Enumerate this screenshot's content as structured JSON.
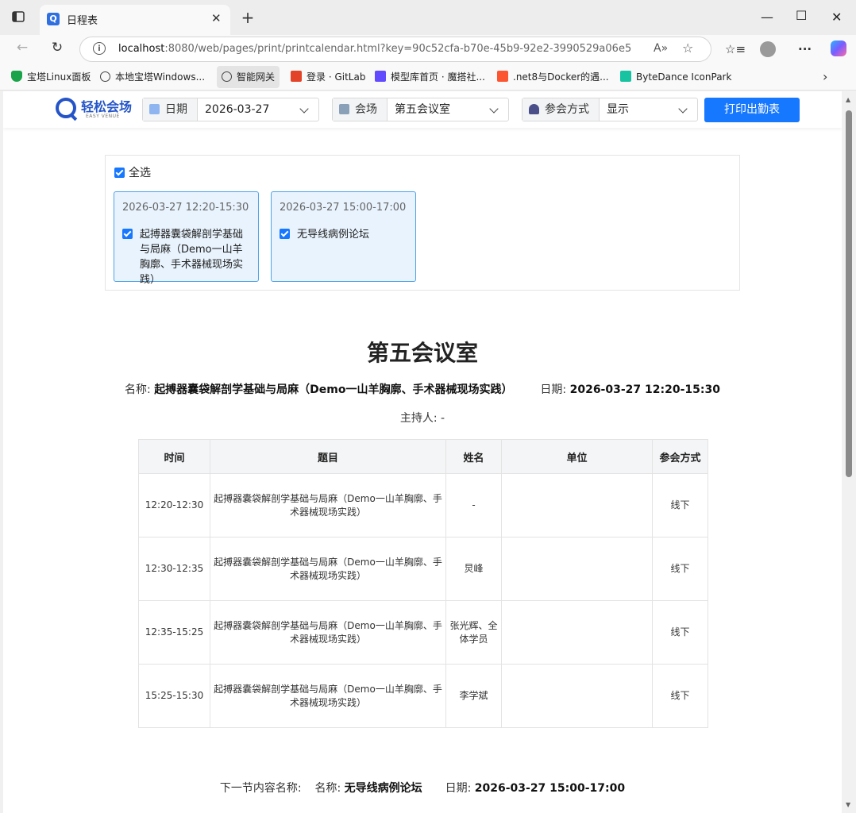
{
  "browser": {
    "tab_title": "日程表",
    "tab_favicon": "Q",
    "address_host": "localhost",
    "address_rest": ":8080/web/pages/print/printcalendar.html?key=90c52cfa-b70e-45b9-92e2-3990529a06e5",
    "bookmarks": [
      {
        "label": "宝塔Linux面板",
        "icon": "shield-icon",
        "color": "#1aa34a"
      },
      {
        "label": "本地宝塔Windows...",
        "icon": "globe-icon",
        "color": "#555555"
      },
      {
        "label": "智能网关",
        "icon": "globe-icon",
        "color": "#555555"
      },
      {
        "label": "登录 · GitLab",
        "icon": "gitlab-icon",
        "color": "#e24329"
      },
      {
        "label": "模型库首页 · 魔搭社...",
        "icon": "modelscope-icon",
        "color": "#624aff"
      },
      {
        "label": ".net8与Docker的遇...",
        "icon": "csdn-icon",
        "color": "#fc5531"
      },
      {
        "label": "ByteDance IconPark",
        "icon": "iconpark-icon",
        "color": "#18c3a2"
      }
    ]
  },
  "app": {
    "logo_name": "轻松会场",
    "logo_sub": "EASY VENUE",
    "date_label": "日期",
    "date_value": "2026-03-27",
    "venue_label": "会场",
    "venue_value": "第五会议室",
    "mode_label": "参会方式",
    "mode_value": "显示",
    "print_button": "打印出勤表"
  },
  "selection": {
    "select_all": "全选",
    "cards": [
      {
        "time": "2026-03-27 12:20-15:30",
        "title": "起搏器囊袋解剖学基础与局麻（Demo一山羊胸廓、手术器械现场实践）"
      },
      {
        "time": "2026-03-27 15:00-17:00",
        "title": "无导线病例论坛"
      }
    ]
  },
  "document": {
    "title": "第五会议室",
    "name_label": "名称:",
    "name_value": "起搏器囊袋解剖学基础与局麻（Demo一山羊胸廓、手术器械现场实践）",
    "date_label": "日期:",
    "date_value": "2026-03-27 12:20-15:30",
    "host_text": "主持人: -",
    "columns": [
      "时间",
      "题目",
      "姓名",
      "单位",
      "参会方式"
    ],
    "rows": [
      {
        "time": "12:20-12:30",
        "topic": "起搏器囊袋解剖学基础与局麻（Demo一山羊胸廓、手术器械现场实践）",
        "name": "-",
        "org": "",
        "mode": "线下"
      },
      {
        "time": "12:30-12:35",
        "topic": "起搏器囊袋解剖学基础与局麻（Demo一山羊胸廓、手术器械现场实践）",
        "name": "炅峰",
        "org": "",
        "mode": "线下"
      },
      {
        "time": "12:35-15:25",
        "topic": "起搏器囊袋解剖学基础与局麻（Demo一山羊胸廓、手术器械现场实践）",
        "name": "张光辉、全体学员",
        "org": "",
        "mode": "线下"
      },
      {
        "time": "15:25-15:30",
        "topic": "起搏器囊袋解剖学基础与局麻（Demo一山羊胸廓、手术器械现场实践）",
        "name": "李学斌",
        "org": "",
        "mode": "线下"
      }
    ],
    "next_label": "下一节内容名称:",
    "next_name_label": "名称:",
    "next_name_value": "无导线病例论坛",
    "next_date_label": "日期:",
    "next_date_value": "2026-03-27 15:00-17:00"
  }
}
